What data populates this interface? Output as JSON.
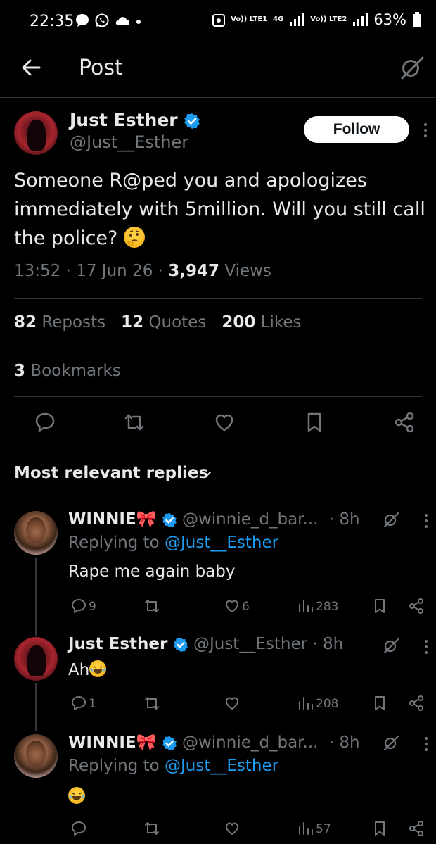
{
  "status_bar": {
    "time": "22:35",
    "network_1": "Vo)) LTE1",
    "network_4g": "4G",
    "network_2": "Vo)) LTE2",
    "battery": "63%"
  },
  "header": {
    "title": "Post"
  },
  "post": {
    "author_name": "Just Esther",
    "author_handle": "@Just__Esther",
    "follow_label": "Follow",
    "text": "Someone R@ped  you and apologizes immediately with 5million. Will you still call the police?",
    "time": "13:52",
    "date": "17 Jun 26",
    "views_count": "3,947",
    "views_label": "Views",
    "reposts_count": "82",
    "reposts_label": "Reposts",
    "quotes_count": "12",
    "quotes_label": "Quotes",
    "likes_count": "200",
    "likes_label": "Likes",
    "bookmarks_count": "3",
    "bookmarks_label": "Bookmarks"
  },
  "sort": {
    "label": "Most relevant replies"
  },
  "replies": [
    {
      "name": "WINNIE",
      "handle": "@winnie_d_bar...",
      "age": "· 8h",
      "replying_prefix": "Replying to",
      "replying_to": "@Just__Esther",
      "text": "Rape me again baby",
      "replies": "9",
      "likes": "6",
      "views": "283"
    },
    {
      "name": "Just Esther",
      "handle": "@Just__Esther",
      "age": "· 8h",
      "text": "Ah",
      "replies": "1",
      "views": "208"
    },
    {
      "name": "WINNIE",
      "handle": "@winnie_d_bar...",
      "age": "· 8h",
      "replying_prefix": "Replying to",
      "replying_to": "@Just__Esther",
      "views": "57"
    }
  ],
  "colors": {
    "accent": "#1d9bf0",
    "muted": "#71767b",
    "text": "#e7e9ea",
    "background": "#000000"
  }
}
